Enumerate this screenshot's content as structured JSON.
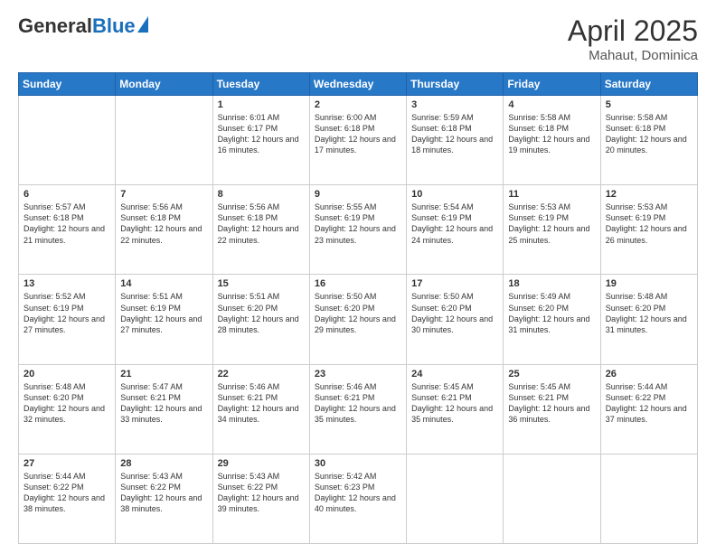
{
  "header": {
    "logo_general": "General",
    "logo_blue": "Blue",
    "month": "April 2025",
    "location": "Mahaut, Dominica"
  },
  "weekdays": [
    "Sunday",
    "Monday",
    "Tuesday",
    "Wednesday",
    "Thursday",
    "Friday",
    "Saturday"
  ],
  "weeks": [
    [
      {
        "day": "",
        "info": ""
      },
      {
        "day": "",
        "info": ""
      },
      {
        "day": "1",
        "info": "Sunrise: 6:01 AM\nSunset: 6:17 PM\nDaylight: 12 hours and 16 minutes."
      },
      {
        "day": "2",
        "info": "Sunrise: 6:00 AM\nSunset: 6:18 PM\nDaylight: 12 hours and 17 minutes."
      },
      {
        "day": "3",
        "info": "Sunrise: 5:59 AM\nSunset: 6:18 PM\nDaylight: 12 hours and 18 minutes."
      },
      {
        "day": "4",
        "info": "Sunrise: 5:58 AM\nSunset: 6:18 PM\nDaylight: 12 hours and 19 minutes."
      },
      {
        "day": "5",
        "info": "Sunrise: 5:58 AM\nSunset: 6:18 PM\nDaylight: 12 hours and 20 minutes."
      }
    ],
    [
      {
        "day": "6",
        "info": "Sunrise: 5:57 AM\nSunset: 6:18 PM\nDaylight: 12 hours and 21 minutes."
      },
      {
        "day": "7",
        "info": "Sunrise: 5:56 AM\nSunset: 6:18 PM\nDaylight: 12 hours and 22 minutes."
      },
      {
        "day": "8",
        "info": "Sunrise: 5:56 AM\nSunset: 6:18 PM\nDaylight: 12 hours and 22 minutes."
      },
      {
        "day": "9",
        "info": "Sunrise: 5:55 AM\nSunset: 6:19 PM\nDaylight: 12 hours and 23 minutes."
      },
      {
        "day": "10",
        "info": "Sunrise: 5:54 AM\nSunset: 6:19 PM\nDaylight: 12 hours and 24 minutes."
      },
      {
        "day": "11",
        "info": "Sunrise: 5:53 AM\nSunset: 6:19 PM\nDaylight: 12 hours and 25 minutes."
      },
      {
        "day": "12",
        "info": "Sunrise: 5:53 AM\nSunset: 6:19 PM\nDaylight: 12 hours and 26 minutes."
      }
    ],
    [
      {
        "day": "13",
        "info": "Sunrise: 5:52 AM\nSunset: 6:19 PM\nDaylight: 12 hours and 27 minutes."
      },
      {
        "day": "14",
        "info": "Sunrise: 5:51 AM\nSunset: 6:19 PM\nDaylight: 12 hours and 27 minutes."
      },
      {
        "day": "15",
        "info": "Sunrise: 5:51 AM\nSunset: 6:20 PM\nDaylight: 12 hours and 28 minutes."
      },
      {
        "day": "16",
        "info": "Sunrise: 5:50 AM\nSunset: 6:20 PM\nDaylight: 12 hours and 29 minutes."
      },
      {
        "day": "17",
        "info": "Sunrise: 5:50 AM\nSunset: 6:20 PM\nDaylight: 12 hours and 30 minutes."
      },
      {
        "day": "18",
        "info": "Sunrise: 5:49 AM\nSunset: 6:20 PM\nDaylight: 12 hours and 31 minutes."
      },
      {
        "day": "19",
        "info": "Sunrise: 5:48 AM\nSunset: 6:20 PM\nDaylight: 12 hours and 31 minutes."
      }
    ],
    [
      {
        "day": "20",
        "info": "Sunrise: 5:48 AM\nSunset: 6:20 PM\nDaylight: 12 hours and 32 minutes."
      },
      {
        "day": "21",
        "info": "Sunrise: 5:47 AM\nSunset: 6:21 PM\nDaylight: 12 hours and 33 minutes."
      },
      {
        "day": "22",
        "info": "Sunrise: 5:46 AM\nSunset: 6:21 PM\nDaylight: 12 hours and 34 minutes."
      },
      {
        "day": "23",
        "info": "Sunrise: 5:46 AM\nSunset: 6:21 PM\nDaylight: 12 hours and 35 minutes."
      },
      {
        "day": "24",
        "info": "Sunrise: 5:45 AM\nSunset: 6:21 PM\nDaylight: 12 hours and 35 minutes."
      },
      {
        "day": "25",
        "info": "Sunrise: 5:45 AM\nSunset: 6:21 PM\nDaylight: 12 hours and 36 minutes."
      },
      {
        "day": "26",
        "info": "Sunrise: 5:44 AM\nSunset: 6:22 PM\nDaylight: 12 hours and 37 minutes."
      }
    ],
    [
      {
        "day": "27",
        "info": "Sunrise: 5:44 AM\nSunset: 6:22 PM\nDaylight: 12 hours and 38 minutes."
      },
      {
        "day": "28",
        "info": "Sunrise: 5:43 AM\nSunset: 6:22 PM\nDaylight: 12 hours and 38 minutes."
      },
      {
        "day": "29",
        "info": "Sunrise: 5:43 AM\nSunset: 6:22 PM\nDaylight: 12 hours and 39 minutes."
      },
      {
        "day": "30",
        "info": "Sunrise: 5:42 AM\nSunset: 6:23 PM\nDaylight: 12 hours and 40 minutes."
      },
      {
        "day": "",
        "info": ""
      },
      {
        "day": "",
        "info": ""
      },
      {
        "day": "",
        "info": ""
      }
    ]
  ]
}
